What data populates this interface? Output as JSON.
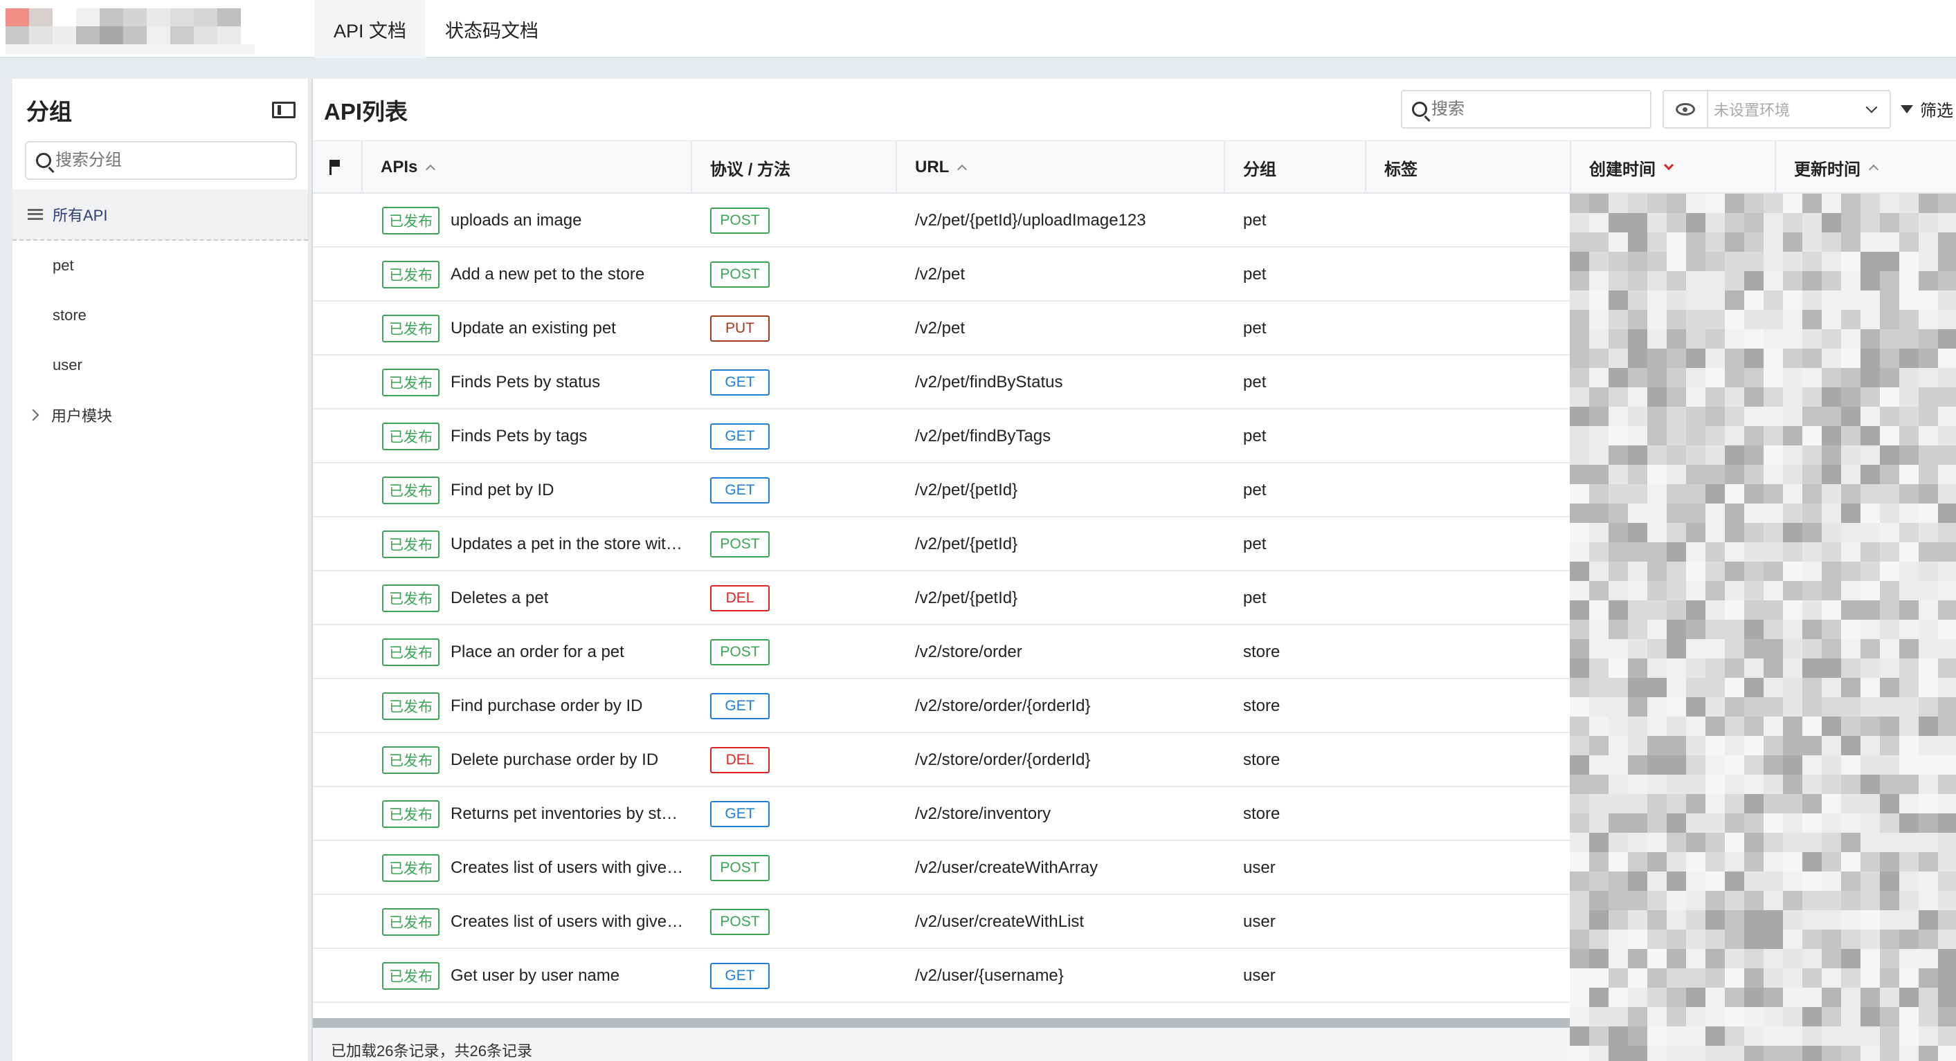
{
  "top_tabs": [
    "API 文档",
    "状态码文档"
  ],
  "left_panel": {
    "title": "分组",
    "search_placeholder": "搜索分组",
    "all_label": "所有API",
    "items": [
      "pet",
      "store",
      "user"
    ],
    "folder": "用户模块"
  },
  "main": {
    "title": "API列表",
    "search_placeholder": "搜索",
    "env_placeholder": "未设置环境",
    "filter_label": "筛选",
    "columns": {
      "apis": "APIs",
      "method": "协议 / 方法",
      "url": "URL",
      "group": "分组",
      "tags": "标签",
      "created": "创建时间",
      "updated": "更新时间"
    },
    "status_label": "已发布",
    "rows": [
      {
        "name": "uploads an image",
        "method": "POST",
        "url": "/v2/pet/{petId}/uploadImage123",
        "group": "pet"
      },
      {
        "name": "Add a new pet to the store",
        "method": "POST",
        "url": "/v2/pet",
        "group": "pet"
      },
      {
        "name": "Update an existing pet",
        "method": "PUT",
        "url": "/v2/pet",
        "group": "pet"
      },
      {
        "name": "Finds Pets by status",
        "method": "GET",
        "url": "/v2/pet/findByStatus",
        "group": "pet"
      },
      {
        "name": "Finds Pets by tags",
        "method": "GET",
        "url": "/v2/pet/findByTags",
        "group": "pet"
      },
      {
        "name": "Find pet by ID",
        "method": "GET",
        "url": "/v2/pet/{petId}",
        "group": "pet"
      },
      {
        "name": "Updates a pet in the store wit…",
        "method": "POST",
        "url": "/v2/pet/{petId}",
        "group": "pet"
      },
      {
        "name": "Deletes a pet",
        "method": "DEL",
        "url": "/v2/pet/{petId}",
        "group": "pet"
      },
      {
        "name": "Place an order for a pet",
        "method": "POST",
        "url": "/v2/store/order",
        "group": "store"
      },
      {
        "name": "Find purchase order by ID",
        "method": "GET",
        "url": "/v2/store/order/{orderId}",
        "group": "store"
      },
      {
        "name": "Delete purchase order by ID",
        "method": "DEL",
        "url": "/v2/store/order/{orderId}",
        "group": "store"
      },
      {
        "name": "Returns pet inventories by st…",
        "method": "GET",
        "url": "/v2/store/inventory",
        "group": "store"
      },
      {
        "name": "Creates list of users with give…",
        "method": "POST",
        "url": "/v2/user/createWithArray",
        "group": "user"
      },
      {
        "name": "Creates list of users with give…",
        "method": "POST",
        "url": "/v2/user/createWithList",
        "group": "user"
      },
      {
        "name": "Get user by user name",
        "method": "GET",
        "url": "/v2/user/{username}",
        "group": "user"
      }
    ],
    "footer": "已加载26条记录，共26条记录"
  }
}
